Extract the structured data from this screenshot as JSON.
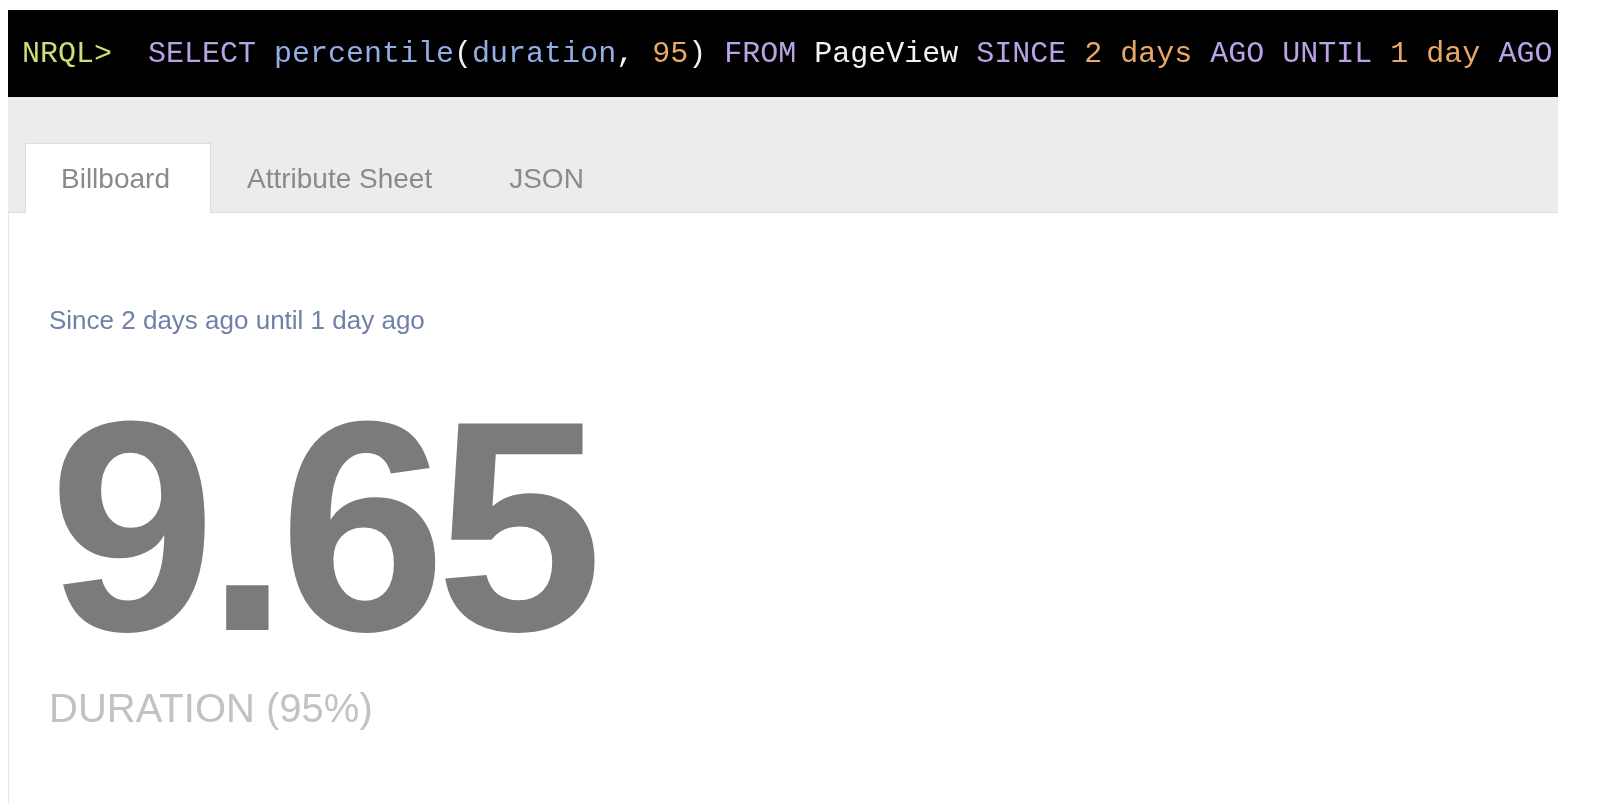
{
  "query": [
    {
      "text": "NRQL>  ",
      "kind": "prompt"
    },
    {
      "text": "SELECT ",
      "kind": "keyword"
    },
    {
      "text": "percentile",
      "kind": "function"
    },
    {
      "text": "(",
      "kind": "plain"
    },
    {
      "text": "duration",
      "kind": "function"
    },
    {
      "text": ", ",
      "kind": "plain"
    },
    {
      "text": "95",
      "kind": "number"
    },
    {
      "text": ") ",
      "kind": "plain"
    },
    {
      "text": "FROM ",
      "kind": "keyword"
    },
    {
      "text": "PageView ",
      "kind": "plain"
    },
    {
      "text": "SINCE ",
      "kind": "keyword"
    },
    {
      "text": "2 days ",
      "kind": "number"
    },
    {
      "text": "AGO ",
      "kind": "keyword"
    },
    {
      "text": "UNTIL ",
      "kind": "keyword"
    },
    {
      "text": "1 day ",
      "kind": "number"
    },
    {
      "text": "AGO",
      "kind": "keyword"
    }
  ],
  "tabs": [
    {
      "label": "Billboard",
      "selected": true
    },
    {
      "label": "Attribute Sheet",
      "selected": false
    },
    {
      "label": "JSON",
      "selected": false
    }
  ],
  "billboard": {
    "time_range": "Since 2 days ago until 1 day ago",
    "value": "9.65",
    "label": "DURATION (95%)"
  }
}
